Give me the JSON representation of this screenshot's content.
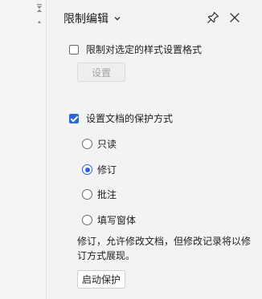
{
  "scroll_indicator": {
    "up_glyph": "▲",
    "down_glyph": "▾"
  },
  "panel": {
    "title": "限制编辑",
    "formatting": {
      "checkbox_label": "限制对选定的样式设置格式",
      "checked": false,
      "settings_button": "设置"
    },
    "protection": {
      "checkbox_label": "设置文档的保护方式",
      "checked": true,
      "options": [
        {
          "label": "只读",
          "selected": false
        },
        {
          "label": "修订",
          "selected": true
        },
        {
          "label": "批注",
          "selected": false
        },
        {
          "label": "填写窗体",
          "selected": false
        }
      ],
      "description": "修订，允许修改文档，但修改记录将以修订方式展现。",
      "start_button": "启动保护"
    }
  },
  "colors": {
    "accent": "#2b64d6",
    "panel_bg": "#f3f3f3"
  }
}
